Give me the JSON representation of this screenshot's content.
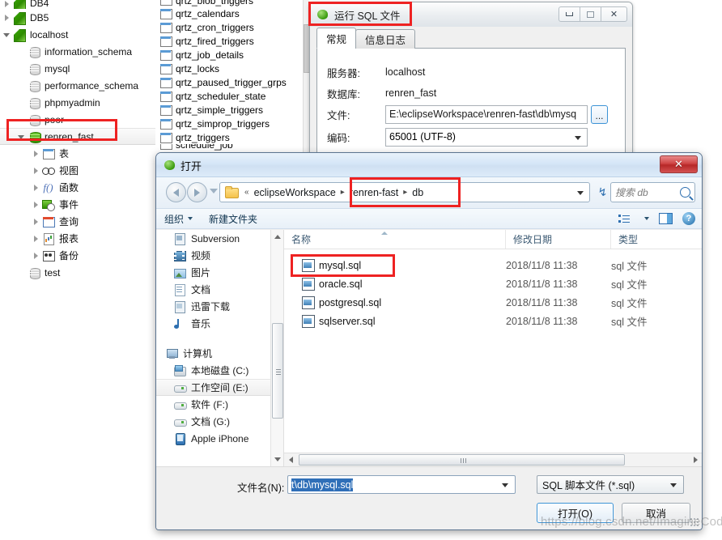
{
  "nav_tree": {
    "items": [
      {
        "label": "DB4",
        "icon": "connection-icon",
        "indent": 0,
        "arrow": "closed",
        "partial": true
      },
      {
        "label": "DB5",
        "icon": "connection-icon",
        "indent": 0,
        "arrow": "closed"
      },
      {
        "label": "localhost",
        "icon": "connection-icon",
        "indent": 0,
        "arrow": "open"
      },
      {
        "label": "information_schema",
        "icon": "database-icon",
        "indent": 1,
        "arrow": "none"
      },
      {
        "label": "mysql",
        "icon": "database-icon",
        "indent": 1,
        "arrow": "none"
      },
      {
        "label": "performance_schema",
        "icon": "database-icon",
        "indent": 1,
        "arrow": "none"
      },
      {
        "label": "phpmyadmin",
        "icon": "database-icon",
        "indent": 1,
        "arrow": "none"
      },
      {
        "label": "poor",
        "icon": "database-icon",
        "indent": 1,
        "arrow": "none"
      },
      {
        "label": "renren_fast",
        "icon": "database-active-icon",
        "indent": 1,
        "arrow": "open",
        "selected": true
      },
      {
        "label": "表",
        "icon": "table-icon",
        "indent": 2,
        "arrow": "closed"
      },
      {
        "label": "视图",
        "icon": "view-icon",
        "indent": 2,
        "arrow": "closed"
      },
      {
        "label": "函数",
        "icon": "function-icon",
        "indent": 2,
        "arrow": "closed"
      },
      {
        "label": "事件",
        "icon": "event-icon",
        "indent": 2,
        "arrow": "closed"
      },
      {
        "label": "查询",
        "icon": "query-icon",
        "indent": 2,
        "arrow": "closed"
      },
      {
        "label": "报表",
        "icon": "report-icon",
        "indent": 2,
        "arrow": "closed"
      },
      {
        "label": "备份",
        "icon": "backup-icon",
        "indent": 2,
        "arrow": "closed"
      },
      {
        "label": "test",
        "icon": "database-icon",
        "indent": 1,
        "arrow": "none"
      }
    ]
  },
  "table_list": {
    "items": [
      {
        "label": "qrtz_blob_triggers",
        "partial": true
      },
      {
        "label": "qrtz_calendars"
      },
      {
        "label": "qrtz_cron_triggers"
      },
      {
        "label": "qrtz_fired_triggers"
      },
      {
        "label": "qrtz_job_details"
      },
      {
        "label": "qrtz_locks"
      },
      {
        "label": "qrtz_paused_trigger_grps"
      },
      {
        "label": "qrtz_scheduler_state"
      },
      {
        "label": "qrtz_simple_triggers"
      },
      {
        "label": "qrtz_simprop_triggers"
      },
      {
        "label": "qrtz_triggers"
      },
      {
        "label": "schedule_job",
        "partial": true
      }
    ]
  },
  "sql_dialog": {
    "title": "运行 SQL 文件",
    "window_buttons": {
      "minimize": "minimize-button",
      "maximize": "maximize-button",
      "close": "✕"
    },
    "tabs": [
      {
        "label": "常规",
        "active": true
      },
      {
        "label": "信息日志",
        "active": false
      }
    ],
    "fields": [
      {
        "label": "服务器:",
        "value": "localhost",
        "type": "text"
      },
      {
        "label": "数据库:",
        "value": "renren_fast",
        "type": "text"
      },
      {
        "label": "文件:",
        "value": "E:\\eclipseWorkspace\\renren-fast\\db\\mysq",
        "type": "input"
      },
      {
        "label": "编码:",
        "value": "65001 (UTF-8)",
        "type": "select"
      }
    ],
    "browse_button": "...",
    "browse_button_name": "browse-file-button"
  },
  "open_dialog": {
    "title": "打开",
    "close_label": "✕",
    "address": {
      "prefix": "«",
      "crumbs": [
        "eclipseWorkspace",
        "renren-fast",
        "db"
      ],
      "separator": "▸"
    },
    "search_placeholder": "搜索 db",
    "toolbar": {
      "organize": "组织",
      "new_folder": "新建文件夹"
    },
    "sidebar": [
      {
        "label": "Subversion",
        "icon": "subversion-icon"
      },
      {
        "label": "视频",
        "icon": "video-icon"
      },
      {
        "label": "图片",
        "icon": "pictures-icon"
      },
      {
        "label": "文档",
        "icon": "documents-icon"
      },
      {
        "label": "迅雷下载",
        "icon": "thunder-download-icon"
      },
      {
        "label": "音乐",
        "icon": "music-icon"
      },
      {
        "spacer": true
      },
      {
        "label": "计算机",
        "icon": "computer-icon"
      },
      {
        "label": "本地磁盘 (C:)",
        "icon": "local-disk-icon"
      },
      {
        "label": "工作空间 (E:)",
        "icon": "drive-icon",
        "selected": true
      },
      {
        "label": "软件 (F:)",
        "icon": "drive-icon"
      },
      {
        "label": "文档 (G:)",
        "icon": "drive-icon"
      },
      {
        "label": "Apple iPhone",
        "icon": "iphone-icon"
      }
    ],
    "file_columns": [
      "名称",
      "修改日期",
      "类型"
    ],
    "files": [
      {
        "name": "mysql.sql",
        "date": "2018/11/8 11:38",
        "type": "sql 文件",
        "selected": true
      },
      {
        "name": "oracle.sql",
        "date": "2018/11/8 11:38",
        "type": "sql 文件"
      },
      {
        "name": "postgresql.sql",
        "date": "2018/11/8 11:38",
        "type": "sql 文件"
      },
      {
        "name": "sqlserver.sql",
        "date": "2018/11/8 11:38",
        "type": "sql 文件"
      }
    ],
    "filename_label": "文件名(N):",
    "filename_value": "t\\db\\mysql.sql",
    "filetype_value": "SQL 脚本文件 (*.sql)",
    "open_button": "打开(O)",
    "cancel_button": "取消"
  },
  "watermark": "https://blog.csdn.net/ImagineCode",
  "colors": {
    "highlight_red": "#ee2222",
    "selection_blue": "#2f6fb8",
    "accent_blue": "#3c93d6"
  }
}
